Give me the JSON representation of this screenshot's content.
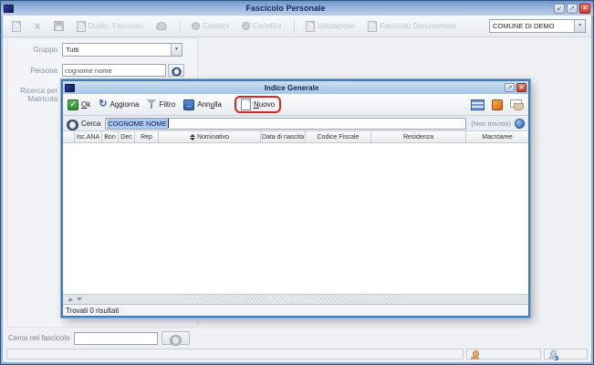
{
  "icons": {
    "minimize": "↙",
    "restore": "↗",
    "close": "×",
    "delete_x": "×",
    "dropdown": "▼",
    "check": "✓",
    "refresh": "↻",
    "arrow_right": "→"
  },
  "colors": {
    "annotation_red": "#cf2b20",
    "selection_bg": "#aac9ef",
    "titlebar_blue": "#8fb0d9"
  },
  "window": {
    "title": "Fascicolo Personale"
  },
  "main_toolbar": {
    "duplic_label": "Duplic. Fascicolo",
    "cedolini_label": "Cedolini",
    "cartellini_label": "Cartellini",
    "valutazione_label": "Valutazione",
    "fascicolo_documentale_label": "Fascicolo Documentale",
    "ente_value": "COMUNE DI DEMO"
  },
  "panel": {
    "gruppo_label": "Gruppo",
    "gruppo_value": "Tutti",
    "persona_label": "Persona",
    "persona_value": "cognome nome",
    "matricola_label_line1": "Ricerca per",
    "matricola_label_line2": "Matricola",
    "matricola_value": ""
  },
  "dialog": {
    "title": "Indice Generale",
    "toolbar": {
      "ok_u": "O",
      "ok_rest": "k",
      "aggiorna_label": "Aggiorna",
      "filtro_label": "Filtro",
      "annulla_pre": "Ann",
      "annulla_u": "u",
      "annulla_rest": "lla",
      "nuovo_u": "N",
      "nuovo_rest": "uovo"
    },
    "search": {
      "label": "Cerca",
      "value": "COGNOME NOME",
      "not_found": "(Non trovato)"
    },
    "table": {
      "headers": [
        "",
        "Isc.ANA",
        "Bon",
        "Dec",
        "Rep",
        "Nominativo",
        "Data di nascita",
        "Codice Fiscale",
        "Residenza",
        "Macroaree"
      ]
    },
    "status": "Trovati 0 risultati"
  },
  "footer": {
    "label": "Cerca nel fascicolo",
    "value": ""
  }
}
